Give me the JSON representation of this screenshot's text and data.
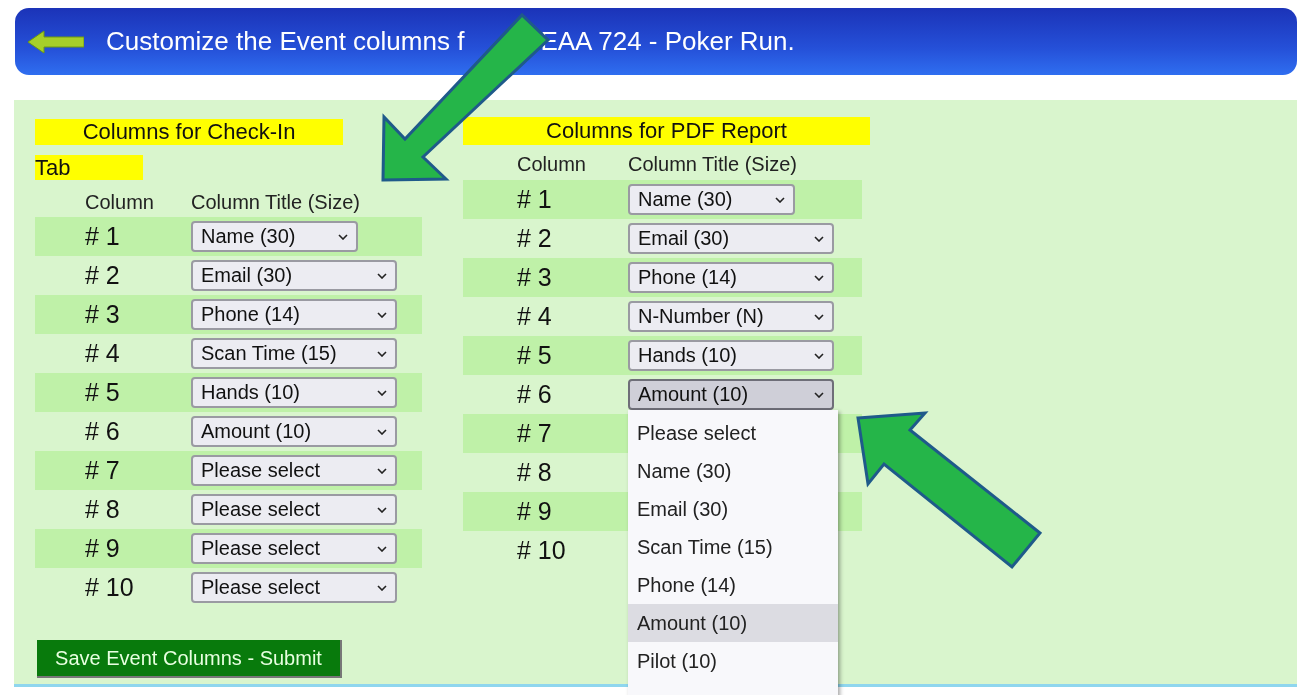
{
  "header": {
    "title_start": "Customize the Event columns f",
    "title_end": "EAA 724 - Poker Run."
  },
  "sections": [
    {
      "title": "Columns for Check-In",
      "title_wrap": "Tab",
      "column_header": "Column",
      "title_header": "Column Title (Size)",
      "rows": [
        {
          "number": "# 1",
          "value": "Name (30)",
          "open": false
        },
        {
          "number": "# 2",
          "value": "Email (30)",
          "open": false
        },
        {
          "number": "# 3",
          "value": "Phone (14)",
          "open": false
        },
        {
          "number": "# 4",
          "value": "Scan Time (15)",
          "open": false
        },
        {
          "number": "# 5",
          "value": "Hands (10)",
          "open": false
        },
        {
          "number": "# 6",
          "value": "Amount (10)",
          "open": false
        },
        {
          "number": "# 7",
          "value": "Please select",
          "open": false
        },
        {
          "number": "# 8",
          "value": "Please select",
          "open": false
        },
        {
          "number": "# 9",
          "value": "Please select",
          "open": false
        },
        {
          "number": "# 10",
          "value": "Please select",
          "open": false
        }
      ]
    },
    {
      "title": "Columns for PDF Report",
      "column_header": "Column",
      "title_header": "Column Title (Size)",
      "rows": [
        {
          "number": "# 1",
          "value": "Name (30)",
          "open": false
        },
        {
          "number": "# 2",
          "value": "Email (30)",
          "open": false
        },
        {
          "number": "# 3",
          "value": "Phone (14)",
          "open": false
        },
        {
          "number": "# 4",
          "value": "N-Number (N)",
          "open": false
        },
        {
          "number": "# 5",
          "value": "Hands (10)",
          "open": false
        },
        {
          "number": "# 6",
          "value": "Amount (10)",
          "open": true,
          "options": [
            {
              "label": "Please select",
              "selected": false
            },
            {
              "label": "Name (30)",
              "selected": false
            },
            {
              "label": "Email (30)",
              "selected": false
            },
            {
              "label": "Scan Time (15)",
              "selected": false
            },
            {
              "label": "Phone (14)",
              "selected": false
            },
            {
              "label": "Amount (10)",
              "selected": true
            },
            {
              "label": "Pilot (10)",
              "selected": false
            }
          ]
        },
        {
          "number": "# 7"
        },
        {
          "number": "# 8"
        },
        {
          "number": "# 9"
        },
        {
          "number": "# 10"
        }
      ]
    }
  ],
  "submit_button": "Save Event Columns - Submit"
}
